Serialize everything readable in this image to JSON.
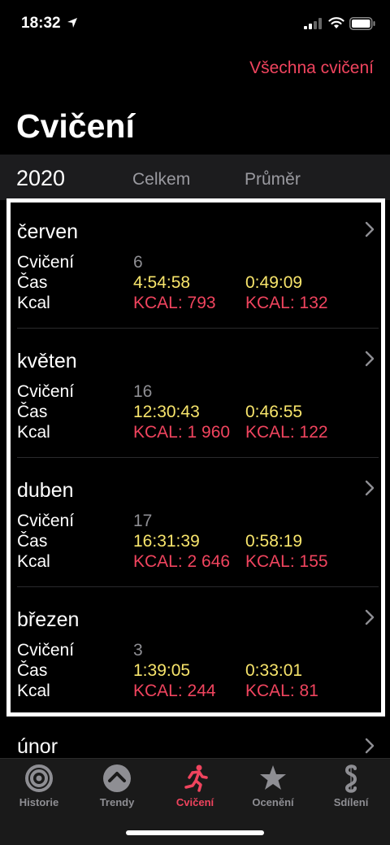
{
  "status": {
    "time": "18:32",
    "icons": [
      "location-arrow-icon",
      "cell-signal-icon",
      "wifi-icon",
      "battery-icon"
    ]
  },
  "header": {
    "all_workouts_link": "Všechna cvičení",
    "title": "Cvičení"
  },
  "year_header": {
    "year": "2020",
    "col_total": "Celkem",
    "col_avg": "Průměr"
  },
  "row_labels": {
    "workouts": "Cvičení",
    "time": "Čas",
    "kcal": "Kcal"
  },
  "months": [
    {
      "name": "červen",
      "count": "6",
      "time_total": "4:54:58",
      "time_avg": "0:49:09",
      "kcal_total": "KCAL: 793",
      "kcal_avg": "KCAL: 132"
    },
    {
      "name": "květen",
      "count": "16",
      "time_total": "12:30:43",
      "time_avg": "0:46:55",
      "kcal_total": "KCAL: 1 960",
      "kcal_avg": "KCAL: 122"
    },
    {
      "name": "duben",
      "count": "17",
      "time_total": "16:31:39",
      "time_avg": "0:58:19",
      "kcal_total": "KCAL: 2 646",
      "kcal_avg": "KCAL: 155"
    },
    {
      "name": "březen",
      "count": "3",
      "time_total": "1:39:05",
      "time_avg": "0:33:01",
      "kcal_total": "KCAL: 244",
      "kcal_avg": "KCAL: 81"
    },
    {
      "name": "únor"
    }
  ],
  "tabs": [
    {
      "label": "Historie",
      "icon": "history-rings-icon",
      "active": false
    },
    {
      "label": "Trendy",
      "icon": "trends-chevron-icon",
      "active": false
    },
    {
      "label": "Cvičení",
      "icon": "running-figure-icon",
      "active": true
    },
    {
      "label": "Ocenění",
      "icon": "awards-star-icon",
      "active": false
    },
    {
      "label": "Sdílení",
      "icon": "sharing-icon",
      "active": false
    }
  ],
  "colors": {
    "accent_red": "#f0445e",
    "accent_yellow": "#f7e46b",
    "secondary_gray": "#8e8e93",
    "background": "#000000"
  }
}
